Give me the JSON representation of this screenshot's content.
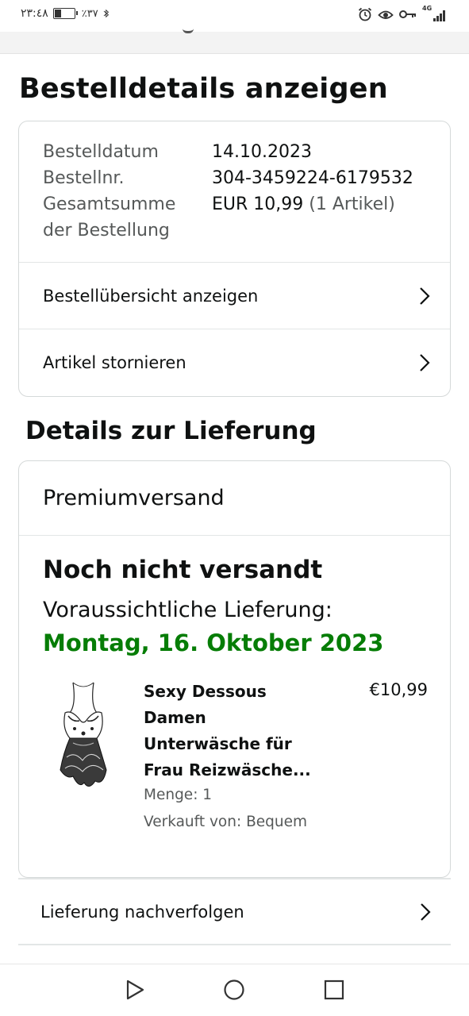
{
  "status_bar": {
    "time": "٢٣:٤٨",
    "battery": "٪٣٧",
    "battery_level": 0.37,
    "icons": [
      "battery-icon",
      "bluetooth-icon",
      "alarm-icon",
      "eye-comfort-icon",
      "vpn-key-icon",
      "signal-4g-icon"
    ],
    "network_label": "4G"
  },
  "page": {
    "title": "Bestelldetails anzeigen"
  },
  "order": {
    "rows": [
      {
        "label": "Bestelldatum",
        "value": "14.10.2023"
      },
      {
        "label": "Bestellnr.",
        "value": "304-3459224-6179532"
      },
      {
        "label": "Gesamtsumme der Bestellung",
        "value": "EUR 10,99",
        "value_suffix": "(1 Artikel)"
      }
    ],
    "label_total_line1": "Gesamtsumme",
    "label_total_line2": "der Bestellung",
    "actions": [
      {
        "label": "Bestellübersicht anzeigen",
        "icon": "chevron-right-icon"
      },
      {
        "label": "Artikel stornieren",
        "icon": "chevron-right-icon"
      }
    ]
  },
  "delivery": {
    "section_title": "Details zur Lieferung",
    "shipping_method": "Premiumversand",
    "status": "Noch nicht versandt",
    "eta_label": "Voraussichtliche Lieferung:",
    "eta_date": "Montag, 16. Oktober 2023",
    "eta_color": "#067d06",
    "item": {
      "title": "Sexy Dessous Damen Unterwäsche für Frau Reizwäsche...",
      "title_lines": [
        "Sexy Dessous",
        "Damen",
        "Unterwäsche für",
        "Frau Reizwäsche..."
      ],
      "price": "€10,99",
      "quantity": "Menge: 1",
      "seller": "Verkauft von: Bequem",
      "image_icon": "lingerie-product-image"
    },
    "track_label": "Lieferung nachverfolgen"
  },
  "system_nav": {
    "buttons": [
      "back-triangle-icon",
      "home-circle-icon",
      "recents-square-icon"
    ]
  }
}
